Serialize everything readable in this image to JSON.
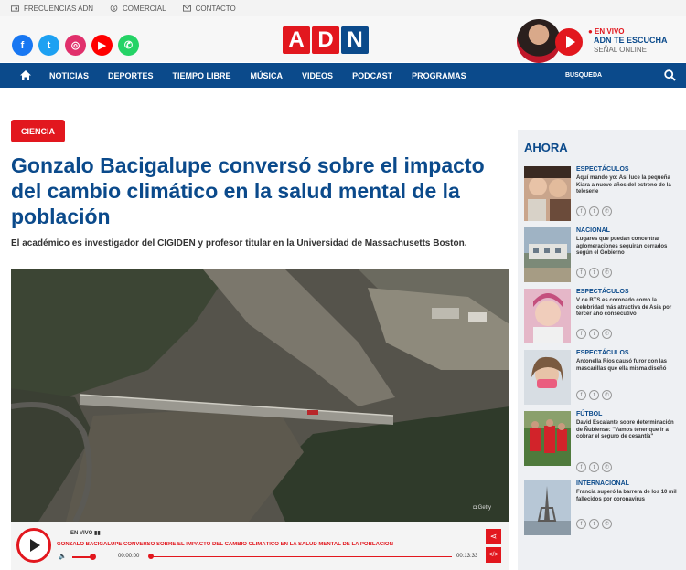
{
  "topbar": {
    "links": [
      {
        "label": "FRECUENCIAS ADN",
        "icon": "radio-icon"
      },
      {
        "label": "COMERCIAL",
        "icon": "dollar-icon"
      },
      {
        "label": "CONTACTO",
        "icon": "mail-icon"
      }
    ]
  },
  "header": {
    "logo": [
      "A",
      "D",
      "N"
    ],
    "social": [
      {
        "icon": "facebook-icon",
        "color": "#1877f2",
        "glyph": "f"
      },
      {
        "icon": "twitter-icon",
        "color": "#1da1f2",
        "glyph": "t"
      },
      {
        "icon": "instagram-icon",
        "color": "#e1306c",
        "glyph": "◎"
      },
      {
        "icon": "youtube-icon",
        "color": "#ff0000",
        "glyph": "▶"
      },
      {
        "icon": "whatsapp-icon",
        "color": "#25d366",
        "glyph": "✆"
      }
    ],
    "live": {
      "label": "● EN VIVO",
      "title": "ADN TE ESCUCHA",
      "subtitle": "SEÑAL ONLINE"
    }
  },
  "nav": {
    "items": [
      "NOTICIAS",
      "DEPORTES",
      "TIEMPO LIBRE",
      "MÚSICA",
      "VIDEOS",
      "PODCAST",
      "PROGRAMAS"
    ],
    "search_placeholder": "BUSQUEDA"
  },
  "article": {
    "category": "CIENCIA",
    "title": "Gonzalo Bacigalupe conversó sobre el impacto del cambio climático en la salud mental de la población",
    "subtitle": "El académico es investigador del CIGIDEN y profesor titular en la Universidad de Massachusetts Boston.",
    "image_credit": "Getty"
  },
  "player": {
    "status": "EN VIVO",
    "title": "GONZALO BACIGALUPE CONVERSÓ SOBRE EL IMPACTO DEL CAMBIO CLIMÁTICO EN LA SALUD MENTAL DE LA POBLACIÓN",
    "current_time": "00:00:00",
    "duration": "00:13:33",
    "volume_level": 0.75,
    "progress": 0
  },
  "sidebar": {
    "heading": "AHORA",
    "items": [
      {
        "category": "ESPECTÁCULOS",
        "text": "Aquí mando yo: Así luce la pequeña Kiara a nueve años del estreno de la teleserie"
      },
      {
        "category": "NACIONAL",
        "text": "Lugares que puedan concentrar aglomeraciones seguirán cerrados según el Gobierno"
      },
      {
        "category": "ESPECTÁCULOS",
        "text": "V de BTS es coronado como la celebridad más atractiva de Asia por tercer año consecutivo"
      },
      {
        "category": "ESPECTÁCULOS",
        "text": "Antonella Ríos causó furor con las mascarillas que ella misma diseñó"
      },
      {
        "category": "FÚTBOL",
        "text": "David Escalante sobre determinación de Ñublense: \"Vamos tener que ir a cobrar el seguro de cesantía\""
      },
      {
        "category": "INTERNACIONAL",
        "text": "Francia superó la barrera de los 10 mil fallecidos por coronavirus"
      }
    ]
  }
}
